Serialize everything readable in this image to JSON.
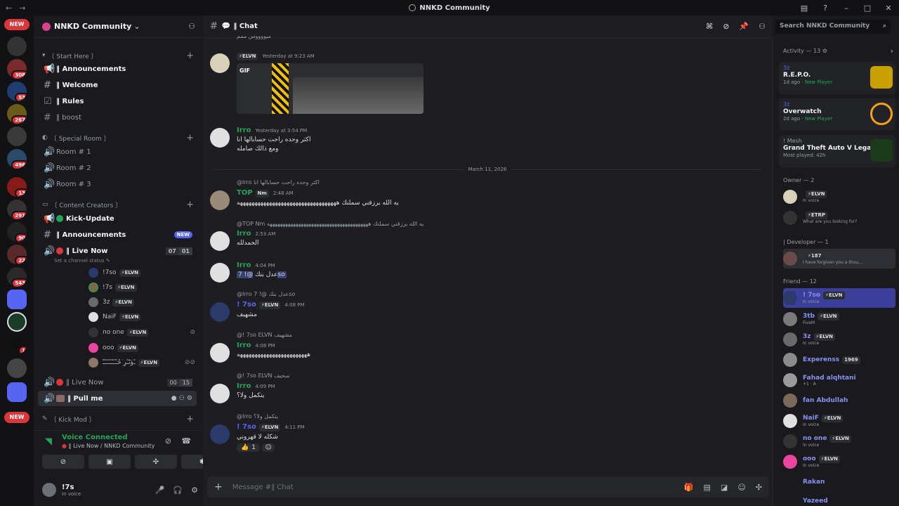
{
  "window": {
    "title": "NNKD Community"
  },
  "guilds": {
    "new_top": "NEW",
    "new_bottom": "NEW",
    "badges": [
      "308",
      "53",
      "267",
      "496",
      "13",
      "291",
      "90",
      "22",
      "543",
      "1"
    ]
  },
  "server": {
    "name": "NNKD Community"
  },
  "categories": {
    "start_here": "〔 Start Here 〕",
    "special_room": "〔 Special Room 〕",
    "content_creators": "〔 Content Creators 〕",
    "kick_mod": "〔 Kick Mod 〕"
  },
  "channels": {
    "announcements": "‖ Announcements",
    "welcome": "‖ Welcome",
    "rules": "‖ Rules",
    "boost": "‖ boost",
    "room1": "Room # 1",
    "room2": "Room # 2",
    "room3": "Room # 3",
    "kick_update": "Kick-Update",
    "announcements2": "‖ Announcements",
    "announcements2_badge": "NEW",
    "live_now": "‖ Live Now",
    "live_now_count": [
      "07",
      "01"
    ],
    "set_status": "Set a channel status",
    "live_now2": "‖ Live Now",
    "live_now2_count": [
      "00",
      "15"
    ],
    "pull_me": "‖ Pull me"
  },
  "voice_users": [
    {
      "name": "!7so",
      "tag": "ELVN"
    },
    {
      "name": "!7s",
      "tag": "ELVN"
    },
    {
      "name": "3z",
      "tag": "ELVN"
    },
    {
      "name": "NaiF",
      "tag": "ELVN"
    },
    {
      "name": "no one",
      "tag": "ELVN"
    },
    {
      "name": "ooo",
      "tag": "ELVN"
    },
    {
      "name": "ـٰٓﯛنٰٓـٰٓرِ ٰٰٓٓحُـٰٓـٰٓـٰٓـٰٓـٰٓـٰٓـٰٓـٰٰٓٓ",
      "tag": "ELVN"
    }
  ],
  "voice": {
    "status": "Voice Connected",
    "location": "‖ Live Now / NNKD Community"
  },
  "user": {
    "name": "!7s",
    "status": "In voice"
  },
  "chat": {
    "channel_name": "‖ Chat",
    "search_placeholder": "Search NNKD Community",
    "composer_placeholder": "Message #‖ Chat",
    "top_snippet": "ميووووس ممم",
    "date_divider": "March 11, 2026",
    "messages": [
      {
        "author": "ELVN",
        "time": "Yesterday at 9:23 AM",
        "gif_label": "GIF"
      },
      {
        "author": "Irro",
        "time": "Yesterday at 3:54 PM",
        "lines": [
          "اكثر وحده راحت حسابالها انا",
          "ومع ذالك صامله"
        ]
      },
      {
        "reply": "@Irro اكثر وحده راحت حسابالها انا",
        "author": "TOP",
        "tag": "Nm",
        "time": "2:48 AM",
        "lines": [
          "يه الله يرزقني سملنك ههههههههههههههههههههههههههههههههههه"
        ]
      },
      {
        "reply": "@TOP Nm يه الله يرزقني سملنك هههههههههههههههههههههههههههههههههههههههه",
        "author": "Irro",
        "time": "2:53 AM",
        "lines": [
          "الحمدلله"
        ]
      },
      {
        "author": "Irro",
        "time": "4:04 PM",
        "lines": [
          "عدل بنك"
        ],
        "mention": "@! 7so"
      },
      {
        "reply": "@Irro عدل بنك @! 7so",
        "author": "! 7so",
        "tag": "ELVN",
        "time": "4:08 PM",
        "lines": [
          "مشهيف"
        ]
      },
      {
        "reply": "@! 7so ELVN مشهيف",
        "author": "Irro",
        "time": "4:08 PM",
        "lines": [
          "ههههههههههههههههههههههههه"
        ]
      },
      {
        "reply": "@! 7so ELVN سحيف",
        "author": "Irro",
        "time": "4:09 PM",
        "lines": [
          "يتكمل ولا؟"
        ]
      },
      {
        "reply": "@Irro يتكمل ولا؟",
        "author": "! 7so",
        "tag": "ELVN",
        "time": "4:11 PM",
        "lines": [
          "شكله لا قهروني"
        ],
        "reaction": {
          "emoji": "👍",
          "count": "1"
        }
      }
    ]
  },
  "activity": {
    "header": "Activity — 13",
    "cards": [
      {
        "user": "3z",
        "game": "R.E.P.O.",
        "time": "1d ago",
        "badge": "New Player"
      },
      {
        "user": "3z",
        "game": "Overwatch",
        "time": "2d ago",
        "badge": "New Player"
      },
      {
        "user": "! Mesh",
        "game": "Grand Theft Auto V Legacy",
        "meta": "Most played: 42h"
      }
    ]
  },
  "members": {
    "owner_header": "Owner — 2",
    "owners": [
      {
        "name": "",
        "tag": "ELVN",
        "sub": "In voice"
      },
      {
        "name": "",
        "tag": "ETRP",
        "sub": "What are you looking for?"
      }
    ],
    "dev_header": "| Developer — 1",
    "developers": [
      {
        "name": "",
        "tag": "187",
        "sub": "I have forgiven you a thou..."
      }
    ],
    "friend_header": "Friend — 12",
    "friends": [
      {
        "name": "! 7so",
        "tag": "ELVN",
        "sub": "In voice"
      },
      {
        "name": "3tb",
        "tag": "ELVN",
        "sub": "FiveM"
      },
      {
        "name": "3z",
        "tag": "ELVN",
        "sub": "In voice"
      },
      {
        "name": "Experenss",
        "tag": "1969",
        "sub": ""
      },
      {
        "name": "Fahad alqhtani",
        "tag": "",
        "sub": "+1 · A"
      },
      {
        "name": "fan Abdullah",
        "tag": "",
        "sub": ""
      },
      {
        "name": "NaiF",
        "tag": "ELVN",
        "sub": "In voice"
      },
      {
        "name": "no one",
        "tag": "ELVN",
        "sub": "In voice"
      },
      {
        "name": "ooo",
        "tag": "ELVN",
        "sub": "In voice"
      },
      {
        "name": "Rakan",
        "tag": "",
        "sub": ""
      },
      {
        "name": "Yazeed",
        "tag": "",
        "sub": ""
      }
    ]
  },
  "colors": {
    "accent": "#5865f2",
    "green": "#23a55a",
    "red": "#da373c"
  }
}
